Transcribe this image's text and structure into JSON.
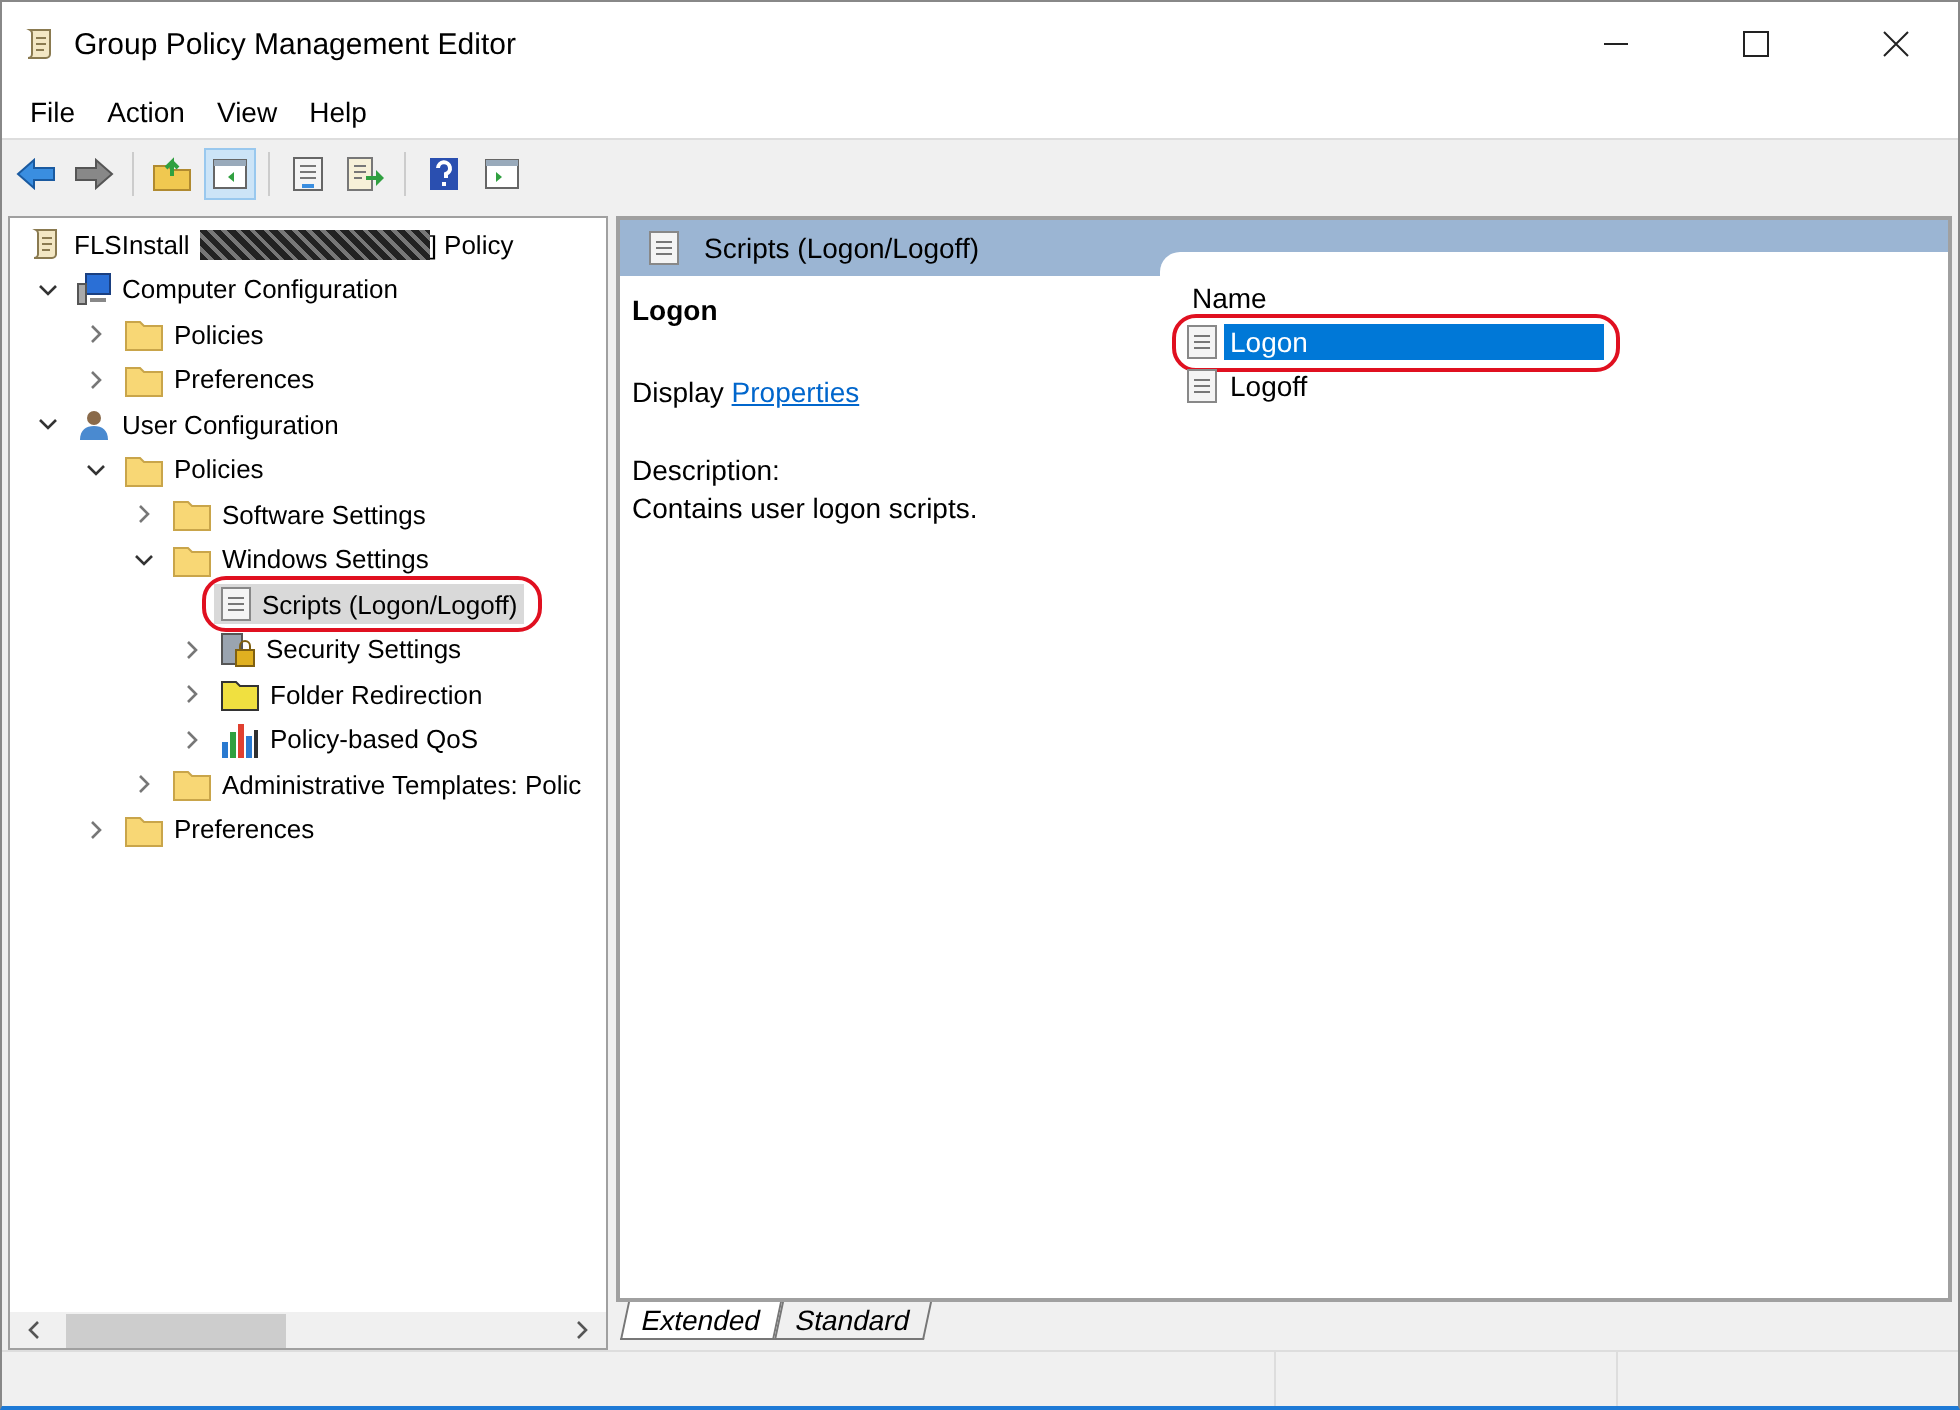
{
  "window": {
    "title": "Group Policy Management Editor"
  },
  "menu": [
    "File",
    "Action",
    "View",
    "Help"
  ],
  "toolbar": [
    {
      "kind": "back",
      "pressed": false
    },
    {
      "kind": "forward",
      "pressed": false
    },
    {
      "kind": "sep"
    },
    {
      "kind": "up",
      "pressed": false
    },
    {
      "kind": "tree",
      "pressed": true
    },
    {
      "kind": "sep"
    },
    {
      "kind": "properties",
      "pressed": false
    },
    {
      "kind": "export",
      "pressed": false
    },
    {
      "kind": "sep"
    },
    {
      "kind": "help",
      "pressed": false
    },
    {
      "kind": "action",
      "pressed": false
    }
  ],
  "tree": [
    {
      "label": "FLSInstall",
      "redacted": true,
      "label_end": "] Policy",
      "kind": "scroll",
      "selected": false,
      "children": [
        {
          "label": "Computer Configuration",
          "kind": "computer",
          "expanded": true,
          "selected": false,
          "children": [
            {
              "label": "Policies",
              "kind": "folder",
              "expanded": false,
              "selected": false
            },
            {
              "label": "Preferences",
              "kind": "folder",
              "expanded": false,
              "selected": false
            }
          ]
        },
        {
          "label": "User Configuration",
          "kind": "user",
          "expanded": true,
          "selected": false,
          "children": [
            {
              "label": "Policies",
              "kind": "folder",
              "expanded": true,
              "selected": false,
              "children": [
                {
                  "label": "Software Settings",
                  "kind": "folder",
                  "expanded": false,
                  "selected": false
                },
                {
                  "label": "Windows Settings",
                  "kind": "folder",
                  "expanded": true,
                  "selected": false,
                  "children": [
                    {
                      "label": "Scripts (Logon/Logoff)",
                      "kind": "script",
                      "selected": true,
                      "circled": true
                    },
                    {
                      "label": "Security Settings",
                      "kind": "lock",
                      "expanded": false,
                      "selected": false
                    },
                    {
                      "label": "Folder Redirection",
                      "kind": "yellowfolder",
                      "expanded": false,
                      "selected": false
                    },
                    {
                      "label": "Policy-based QoS",
                      "kind": "chart",
                      "expanded": false,
                      "selected": false
                    }
                  ]
                },
                {
                  "label": "Administrative Templates: Polic",
                  "kind": "folder",
                  "expanded": false,
                  "selected": false
                }
              ]
            },
            {
              "label": "Preferences",
              "kind": "folder",
              "expanded": false,
              "selected": false
            }
          ]
        }
      ]
    }
  ],
  "pane": {
    "header": "Scripts (Logon/Logoff)",
    "detail_title": "Logon",
    "display_label": "Display",
    "display_link": "Properties",
    "description_label": "Description:",
    "description": "Contains user logon scripts.",
    "list": {
      "column": "Name",
      "items": [
        {
          "label": "Logon",
          "selected": true,
          "circled": true
        },
        {
          "label": "Logoff",
          "selected": false,
          "circled": false
        }
      ]
    }
  },
  "tabs": [
    {
      "label": "Extended",
      "selected": true
    },
    {
      "label": "Standard",
      "selected": false
    }
  ]
}
